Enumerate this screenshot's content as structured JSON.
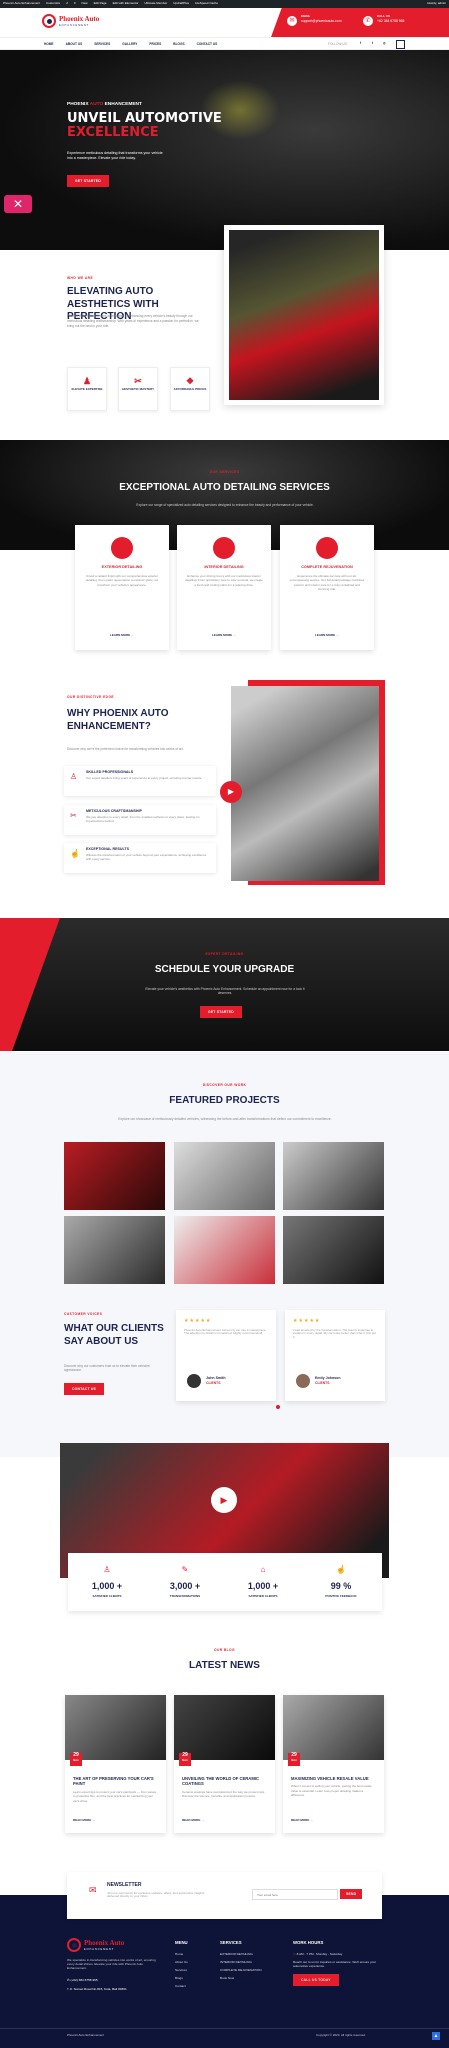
{
  "admin_bar": {
    "items": [
      "Phoenix Auto Enhancement",
      "Customize",
      "2",
      "0",
      "New",
      "Edit Page",
      "Edit with Elementor",
      "Ultimate Member",
      "UpdraftPlus",
      "LiteSpeed Cache",
      "Howdy, admin"
    ]
  },
  "header": {
    "logo_text": "Phoenix Auto",
    "logo_sub": "ENHANCEMENT",
    "email_label": "EMAIL",
    "email": "support@phoenixauto.com",
    "call_label": "CALL US",
    "phone": "+62 384 6758 965"
  },
  "nav": {
    "items": [
      "HOME",
      "ABOUT US",
      "SERVICES",
      "GALLERY",
      "PRICES",
      "BLOGS",
      "CONTACT US"
    ],
    "follow": "FOLLOW US:"
  },
  "hero": {
    "eyebrow_a": "PHOENIX",
    "eyebrow_b": "AUTO",
    "eyebrow_c": "ENHANCEMENT",
    "title_a": "UNVEIL AUTOMOTIVE",
    "title_b": "EXCELLENCE",
    "desc": "Experience meticulous detailing that transforms your vehicle into a masterpiece. Elevate your ride today.",
    "cta": "GET STARTED"
  },
  "about": {
    "tag": "WHO WE ARE",
    "title": "ELEVATING AUTO AESTHETICS WITH PERFECTION",
    "desc": "Phoenix Auto Enhancement is dedicated to enhancing every vehicle's beauty through our meticulous detailing craftsmanship. With years of experience and a passion for perfection, we bring out the best in your ride.",
    "features": [
      "ELEVATE EXPERTISE",
      "AESTHETIC MASTERY",
      "AFFORDABLE PRICES"
    ]
  },
  "services": {
    "tag": "OUR SERVICES",
    "title": "EXCEPTIONAL AUTO DETAILING SERVICES",
    "desc": "Explore our range of specialized auto detailing services designed to enhance the beauty and performance of your vehicle.",
    "cards": [
      {
        "title": "EXTERIOR DETAILING",
        "desc": "Unveil a radiant finish with our comprehensive exterior detailing. From paint rejuvenation to ceramic glaze, we transform your vehicle's appearance.",
        "link": "LEARN MORE"
      },
      {
        "title": "INTERIOR DETAILING",
        "desc": "Enhance your driving luxury with our meticulous interior detailing. From upholstery care to odor removal, we create a fresh and inviting cabin for a relaxing drive.",
        "link": "LEARN MORE"
      },
      {
        "title": "COMPLETE REJUVENATION",
        "desc": "Experience the ultimate car care with our all-encompassing service. Our full detail package combines exterior and interior care for a truly revitalized and stunning ride.",
        "link": "LEARN MORE"
      }
    ]
  },
  "why": {
    "tag": "OUR DISTINCTIVE EDGE",
    "title": "WHY PHOENIX AUTO ENHANCEMENT?",
    "desc": "Discover why we're the preferred choice for transforming vehicles into works of art.",
    "items": [
      {
        "title": "SKILLED PROFESSIONALS",
        "desc": "Our expert detailers bring years of experience to every project, ensuring top-tier results."
      },
      {
        "title": "METICULOUS CRAFTSMANSHIP",
        "desc": "We pay attention to every detail, from the smallest surfaces to every place, leaving no imperfections behind."
      },
      {
        "title": "EXCEPTIONAL RESULTS",
        "desc": "Witness the transformation of your vehicle beyond your expectations, achieving excellence with every service."
      }
    ]
  },
  "cta": {
    "tag": "EXPERT DETAILING",
    "title": "SCHEDULE YOUR UPGRADE",
    "desc": "Elevate your vehicle's aesthetics with Phoenix Auto Enhancement. Schedule an appointment now for a look it deserves.",
    "button": "GET STARTED"
  },
  "projects": {
    "tag": "DISCOVER OUR WORK",
    "title": "FEATURED PROJECTS",
    "desc": "Explore our showcase of meticulously detailed vehicles, witnessing the before-and-after transformations that define our commitment to excellence."
  },
  "testimonials": {
    "tag": "CUSTOMER VOICES",
    "title": "WHAT OUR CLIENTS SAY ABOUT US",
    "desc": "Discover why our customers trust us to elevate their vehicles' appearance.",
    "button": "CONTACT US",
    "items": [
      {
        "text": "Phoenix Auto Enhancement turned my car into a masterpiece. The attention to detail is unmatched. Highly recommended!",
        "name": "John Smith",
        "role": "CLIENTS"
      },
      {
        "text": "I was amazed by the transformation. The team's expertise is evident in every detail. My car looks better than when I first got it.",
        "name": "Emily Johnson",
        "role": "CLIENTS"
      }
    ]
  },
  "stats": [
    {
      "value": "1,000 +",
      "label": "SATISFIED CLIENTS"
    },
    {
      "value": "3,000 +",
      "label": "TRANSFORMATIONS"
    },
    {
      "value": "1,000 +",
      "label": "SATISFIED CLIENTS"
    },
    {
      "value": "99 %",
      "label": "POSITIVE FEEDBACK"
    }
  ],
  "blog": {
    "tag": "OUR BLOG",
    "title": "LATEST NEWS",
    "items": [
      {
        "day": "29",
        "mon": "Nov",
        "title": "THE ART OF PRESERVING YOUR CAR'S PAINT",
        "desc": "Learn expert tips to protect your car's paintwork — from waxes to protective film, and the best practices for maintaining your car's shine.",
        "link": "READ MORE"
      },
      {
        "day": "29",
        "mon": "Nov",
        "title": "UNVEILING THE WORLD OF CERAMIC COATINGS",
        "desc": "Ceramic coatings have revolutionized the way we protect cars. Discover the science, benefits, and application process.",
        "link": "READ MORE"
      },
      {
        "day": "29",
        "mon": "Nov",
        "title": "MAXIMIZING VEHICLE RESALE VALUE",
        "desc": "When it comes to selling your vehicle, getting the best resale value is essential. Learn how proper detailing makes a difference.",
        "link": "READ MORE"
      }
    ]
  },
  "newsletter": {
    "title": "NEWSLETTER",
    "desc": "Join our community for exclusive updates, offers, and automotive insights delivered directly to your inbox.",
    "placeholder": "Your email here",
    "button": "SEND"
  },
  "footer": {
    "about": "We specialize in transforming vehicles into works of art, ensuring every detail shines. Elevate your ride with Phoenix Auto Enhancement.",
    "phone": "(+62) 384 6758 965",
    "address": "Jl. Sunset Road No.815, Kuta, Bali 80361",
    "menu_title": "MENU",
    "menu": [
      "Home",
      "About Us",
      "Services",
      "Blogs",
      "Contact"
    ],
    "services_title": "SERVICES",
    "services": [
      "EXTERIOR DETAILING",
      "INTERIOR DETAILING",
      "COMPLETE REJUVENATION",
      "Book Now"
    ],
    "hours_title": "WORK HOURS",
    "hours": "8 AM - 7 PM , Monday - Saturday",
    "hours_desc": "Reach out to us for inquiries or assistance. We'll ensure your automotive experience.",
    "call": "CALL US TODAY",
    "copy_left": "Phoenix Auto Enhancement",
    "copy_right": "Copyright © 2023. All rights reserved."
  }
}
